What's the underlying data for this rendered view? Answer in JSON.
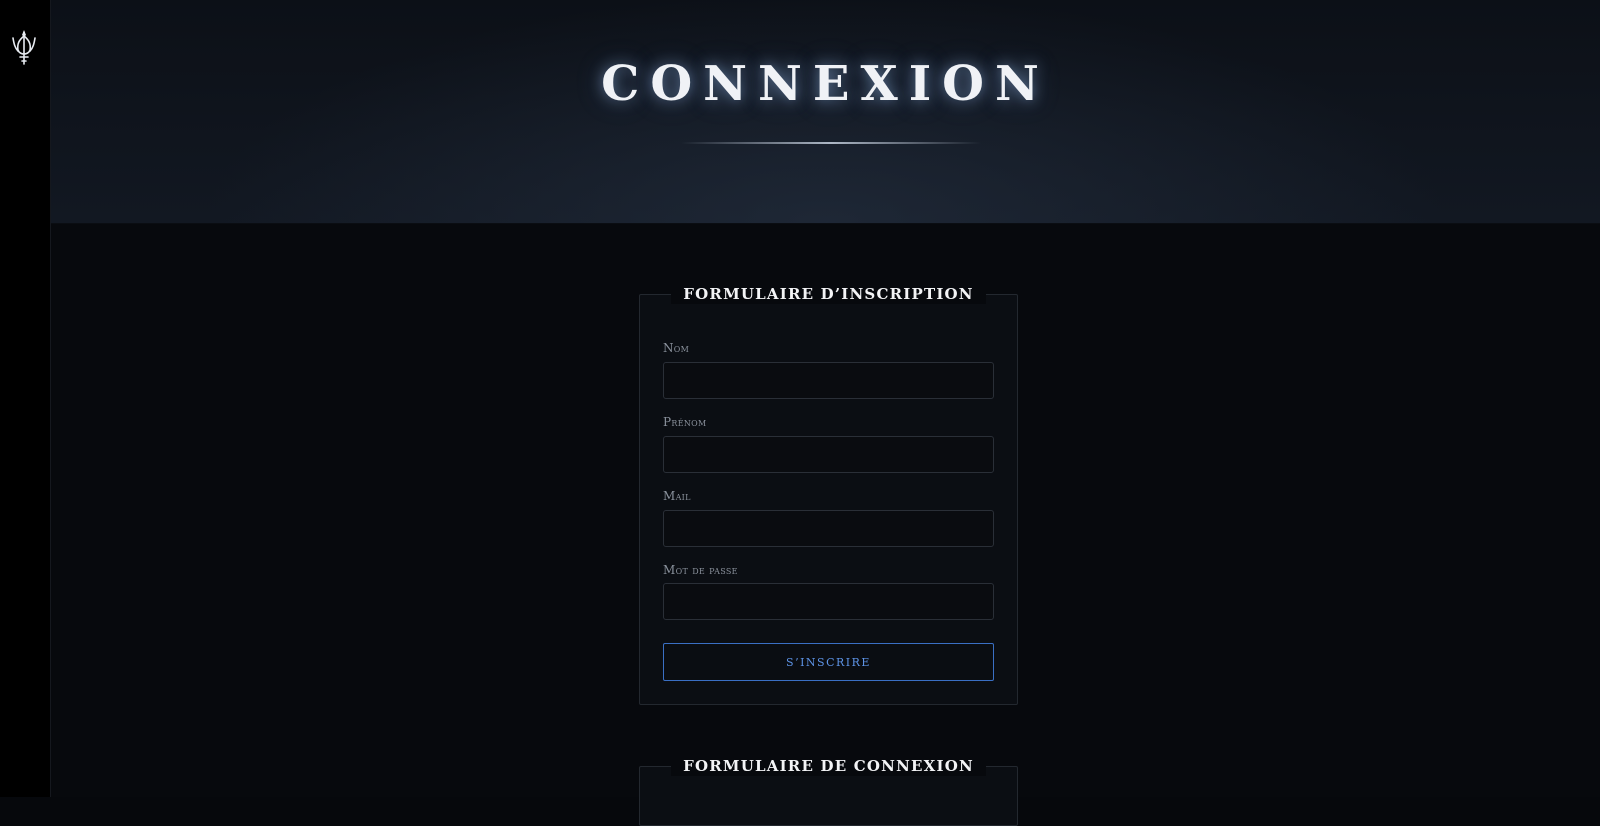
{
  "sidebar": {
    "logo_icon": "trident-emblem-icon"
  },
  "hero": {
    "title": "CONNEXION"
  },
  "register_form": {
    "title": "FORMULAIRE D’INSCRIPTION",
    "fields": [
      {
        "label": "Nom",
        "value": "",
        "placeholder": ""
      },
      {
        "label": "Prénom",
        "value": "",
        "placeholder": ""
      },
      {
        "label": "Mail",
        "value": "",
        "placeholder": ""
      },
      {
        "label": "Mot de passe",
        "value": "",
        "placeholder": ""
      }
    ],
    "submit_label": "S’INSCRIRE"
  },
  "login_form": {
    "title": "FORMULAIRE DE CONNEXION"
  },
  "colors": {
    "accent": "#3a6fc4",
    "accent_text": "#5d93e6",
    "background": "#07090d",
    "panel": "#0b0e13"
  }
}
